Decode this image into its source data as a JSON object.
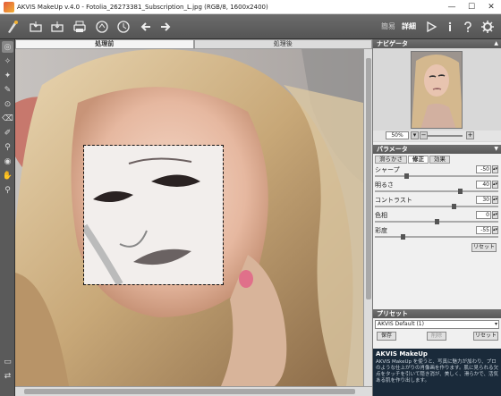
{
  "titlebar": {
    "title": "AKVIS MakeUp v.4.0 - Fotolia_26273381_Subscription_L.jpg (RGB/8, 1600x2400)",
    "minimize": "—",
    "maximize": "☐",
    "close": "✕"
  },
  "toolbar": {
    "mode_simple": "簡易",
    "mode_advanced": "詳細"
  },
  "view_tabs": {
    "before": "処理前",
    "after": "処理後"
  },
  "navigator": {
    "title": "ナビゲータ",
    "zoom": "50%"
  },
  "params": {
    "title": "パラメータ",
    "tabs": [
      "滑らかさ",
      "修正",
      "効果"
    ],
    "active_tab": "修正",
    "rows": [
      {
        "label": "シャープ",
        "value": "-50",
        "level": 0.25
      },
      {
        "label": "明るさ",
        "value": "40",
        "level": 0.7
      },
      {
        "label": "コントラスト",
        "value": "30",
        "level": 0.65
      },
      {
        "label": "色相",
        "value": "0",
        "level": 0.5
      },
      {
        "label": "彩度",
        "value": "-55",
        "level": 0.22
      }
    ],
    "reset": "リセット"
  },
  "presets": {
    "title": "プリセット",
    "selected": "AKVIS Default (1)",
    "save": "保存",
    "delete": "削除",
    "reset": "リセット"
  },
  "info": {
    "title": "AKVIS MakeUp",
    "text": "AKVIS MakeUp を使うと、写真に魅力が加わり、プロのような仕上がりの肖像画を作ります。肌に見られる欠点をタッチを引いて隠き消が、美しく、滑らかで、活気ある肌を作り出します。"
  },
  "colors": {
    "toolbar": "#5f5f5f",
    "panel_header": "#636363",
    "panel_bg": "#f0f0f0",
    "info_bg": "#1a2a3a"
  }
}
